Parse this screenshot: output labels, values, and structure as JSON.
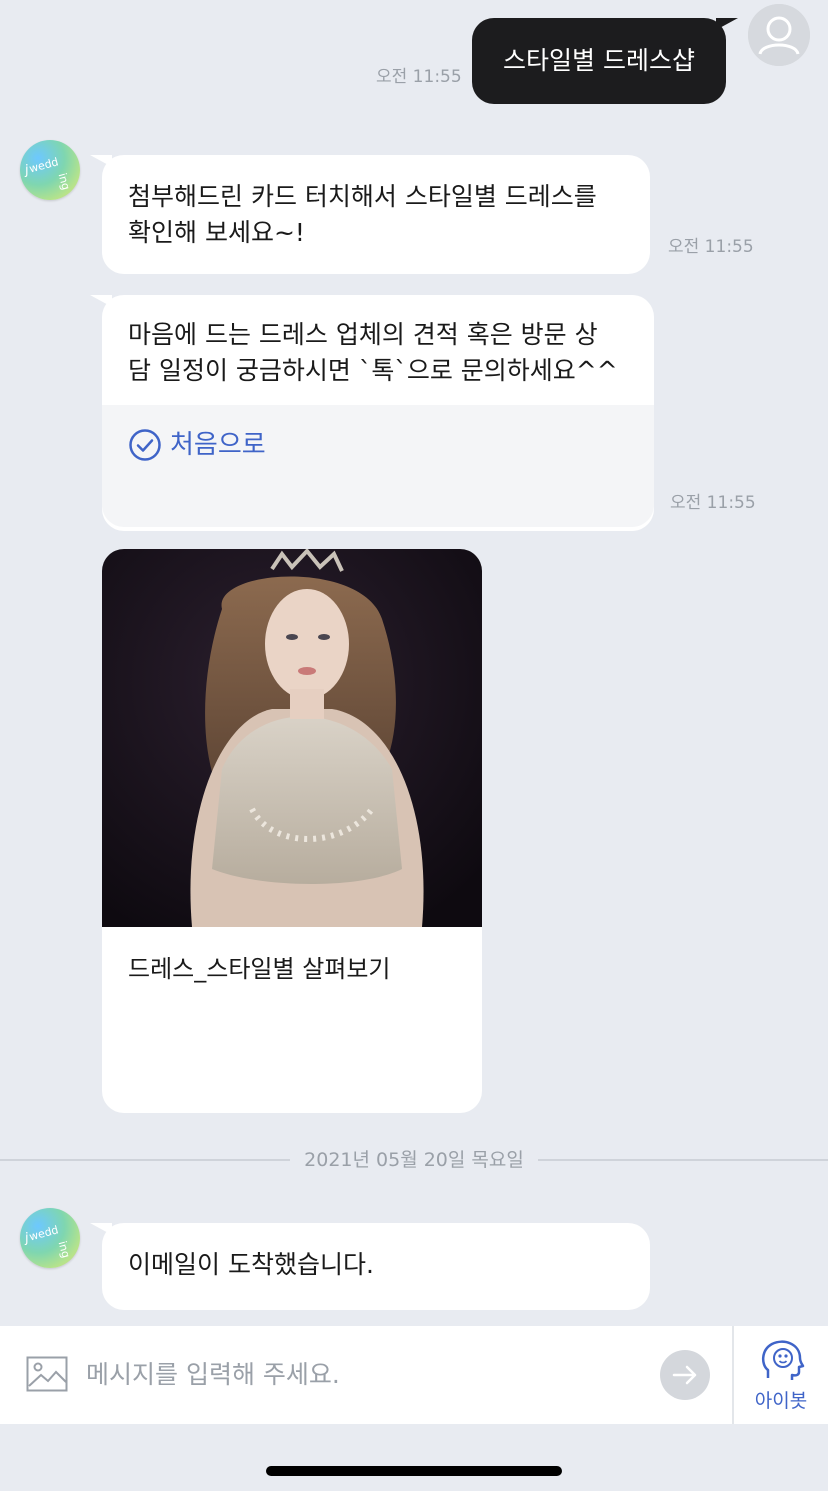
{
  "messages": {
    "user_message": {
      "text": "스타일별 드레스샵",
      "time": "오전 11:55"
    },
    "bot_message_1": {
      "text_line1": "첨부해드린 카드 터치해서 스타일별 드레스를",
      "text_line2": "확인해 보세요~!",
      "time": "오전 11:55"
    },
    "bot_message_2": {
      "text_line1": "마음에 드는 드레스 업체의 견적 혹은 방문 상",
      "text_line2": "담 일정이 궁금하시면 `톡`으로 문의하세요^^",
      "action_label": "처음으로",
      "time": "오전 11:55"
    },
    "card": {
      "title": "드레스_스타일별 살펴보기"
    },
    "date_divider": "2021년 05월 20일 목요일",
    "bot_message_3": {
      "text": "이메일이 도착했습니다."
    }
  },
  "input_bar": {
    "placeholder": "메시지를 입력해 주세요.",
    "bot_button_label": "아이봇"
  },
  "colors": {
    "background": "#e8ebf1",
    "user_bubble": "#1c1c1e",
    "bot_bubble": "#ffffff",
    "accent": "#3f64c8",
    "timestamp": "#9aa0a8"
  },
  "icons": [
    "user-avatar-icon",
    "bot-avatar-logo",
    "check-circle-icon",
    "image-icon",
    "send-arrow-icon",
    "bot-head-icon"
  ]
}
